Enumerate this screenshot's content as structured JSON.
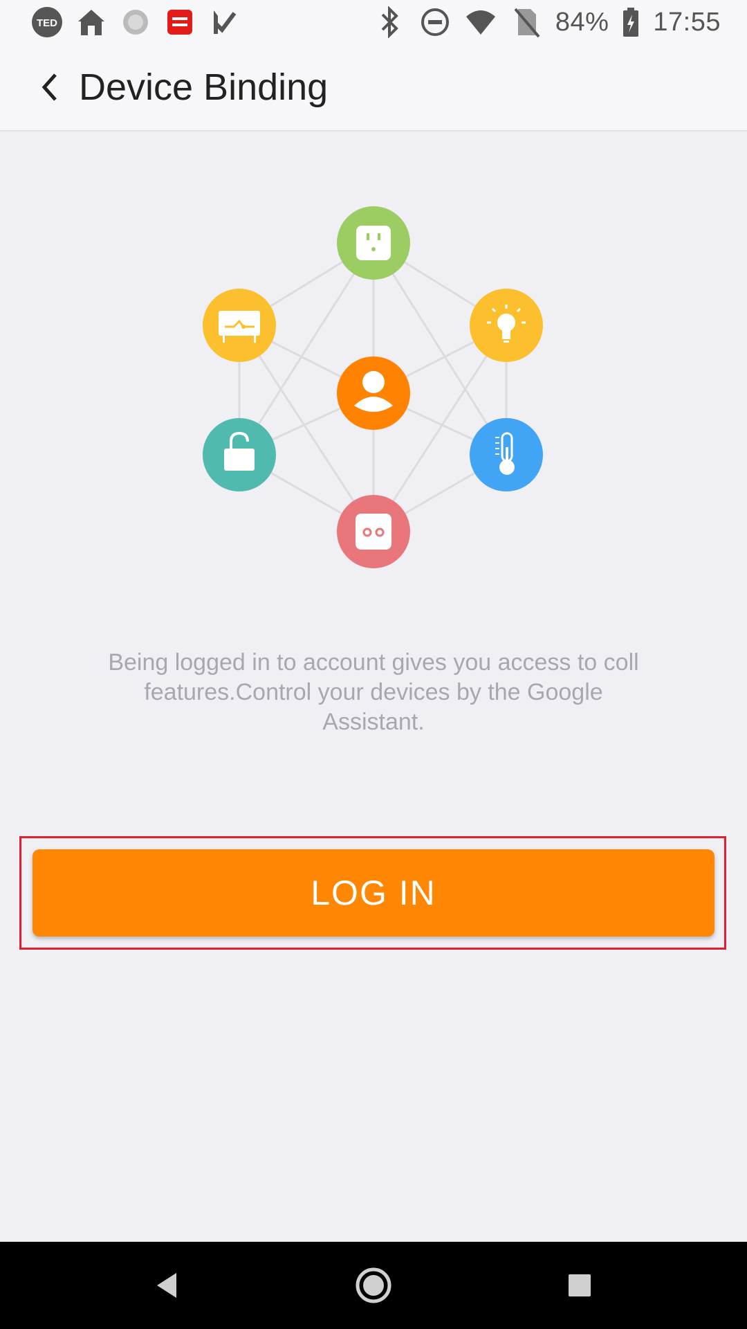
{
  "status_bar": {
    "battery_percent": "84%",
    "time": "17:55",
    "left_icons": [
      "ted-icon",
      "home-icon",
      "loading-icon",
      "youdao-icon",
      "check-icon"
    ],
    "right_icons": [
      "bluetooth-icon",
      "do-not-disturb-icon",
      "wifi-icon",
      "no-sim-icon",
      "battery-charging-icon"
    ]
  },
  "app_bar": {
    "title": "Device Binding"
  },
  "illustration": {
    "center_icon": "person-icon",
    "nodes": [
      "socket-icon",
      "light-bulb-icon",
      "thermometer-icon",
      "outlet-icon",
      "lock-icon",
      "switch-icon"
    ],
    "colors": {
      "center": "#ff8200",
      "socket": "#9ccd62",
      "switch": "#fcc02e",
      "bulb": "#fcc02e",
      "lock": "#4fbaad",
      "thermometer": "#42a4f4",
      "outlet": "#e9767a",
      "lines": "#dcdce0"
    }
  },
  "description": "Being logged in to account gives you access to coll features.Control your devices by the Google Assistant.",
  "login_button": {
    "label": "LOG IN",
    "color": "#ff8703",
    "highlight_color": "#e0202e"
  },
  "nav_bar": {
    "items": [
      "back-nav-icon",
      "home-nav-icon",
      "recents-nav-icon"
    ]
  }
}
